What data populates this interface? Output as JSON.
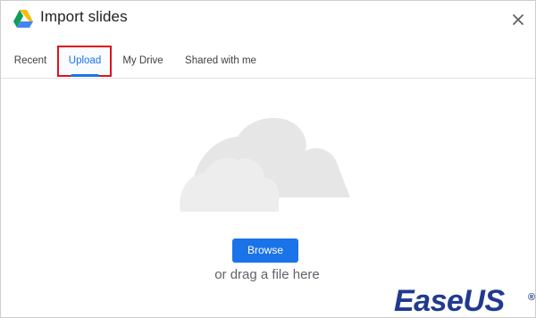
{
  "window": {
    "title": "Import slides",
    "close_icon": "close-icon",
    "logo_icon": "google-drive-icon"
  },
  "tabs": [
    {
      "label": "Recent"
    },
    {
      "label": "Upload",
      "active": true
    },
    {
      "label": "My Drive"
    },
    {
      "label": "Shared with me"
    }
  ],
  "upload": {
    "browse_label": "Browse",
    "drag_hint": "or drag a file here",
    "illustration_icon": "cloud-icon"
  },
  "watermark": {
    "text_ease": "Ease",
    "text_us": "US",
    "registered": "®"
  },
  "colors": {
    "accent": "#1a73e8",
    "highlight_border": "#e0121b",
    "brand_watermark": "#1f3a8f"
  }
}
